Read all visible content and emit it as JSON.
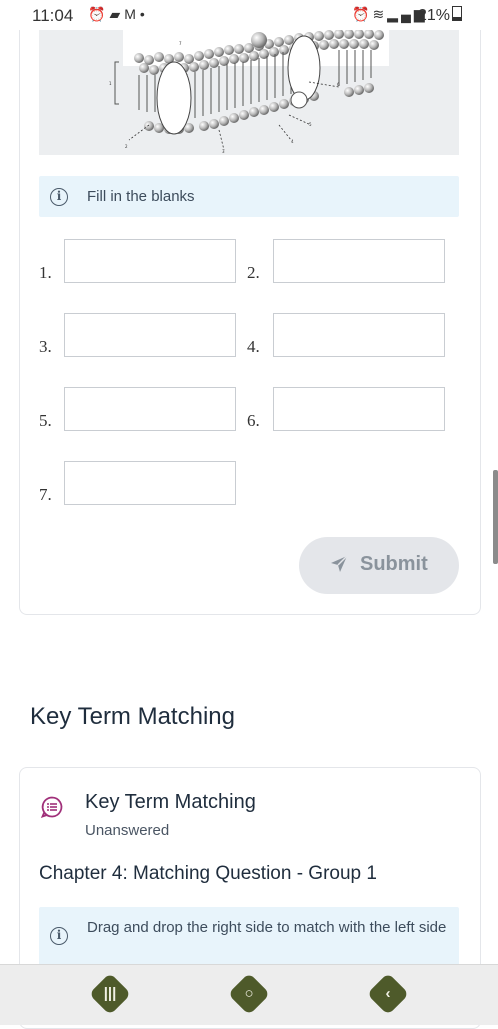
{
  "status_bar": {
    "time": "11:04",
    "battery": "21%",
    "left_icons": [
      "alarm-icon",
      "message-icon",
      "gmail-icon",
      "dot-icon"
    ],
    "right_icons": [
      "alarm-icon",
      "wifi-icon",
      "signal-icon",
      "battery-icon"
    ]
  },
  "fill_in": {
    "instruction": "Fill in the blanks",
    "blanks": [
      {
        "number": "1.",
        "value": ""
      },
      {
        "number": "2.",
        "value": ""
      },
      {
        "number": "3.",
        "value": ""
      },
      {
        "number": "4.",
        "value": ""
      },
      {
        "number": "5.",
        "value": ""
      },
      {
        "number": "6.",
        "value": ""
      },
      {
        "number": "7.",
        "value": ""
      }
    ],
    "diagram_labels": [
      "1",
      "2",
      "3",
      "4",
      "5",
      "6",
      "7"
    ],
    "submit_label": "Submit"
  },
  "section": {
    "title": "Key Term Matching"
  },
  "matching": {
    "title": "Key Term Matching",
    "status": "Unanswered",
    "question": "Chapter 4: Matching Question - Group 1",
    "instruction": "Drag and drop the right side to match with the left side"
  },
  "colors": {
    "info_bg": "#e8f4fb",
    "submit_bg": "#e4e6ea",
    "nav_button": "#4e5a2a",
    "icon_accent": "#a0307a"
  },
  "nav": {
    "icons": [
      "recent-apps-icon",
      "home-icon",
      "back-icon"
    ]
  }
}
